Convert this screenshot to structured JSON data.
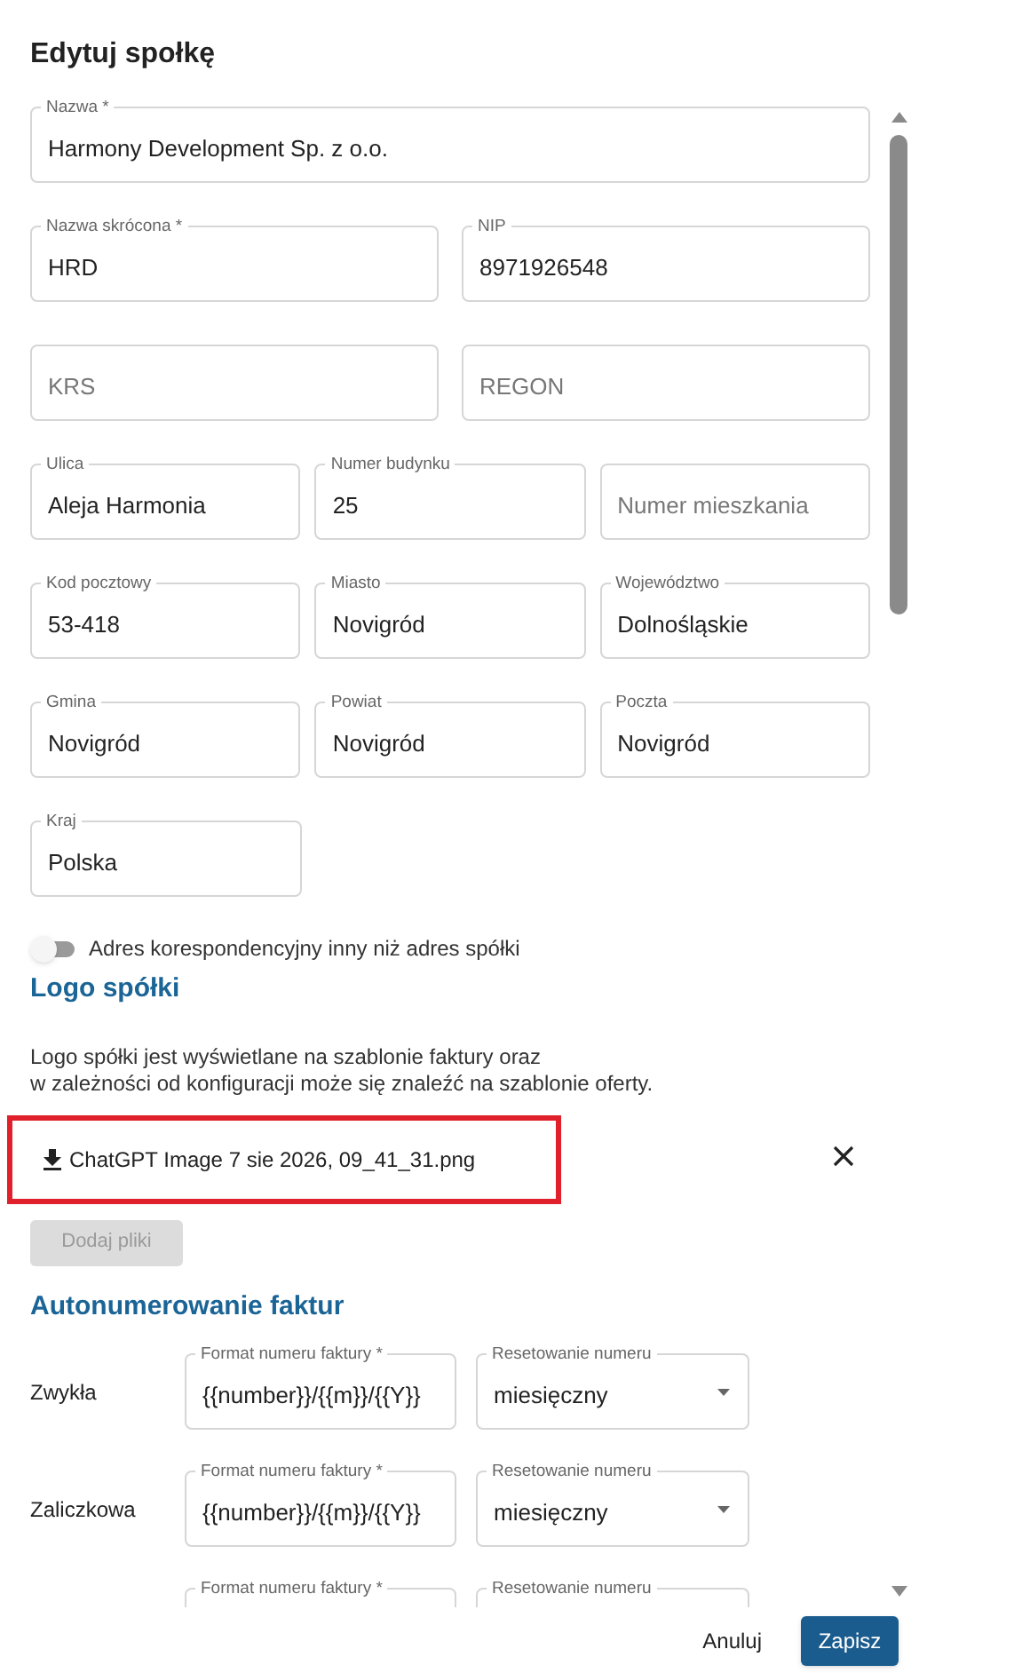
{
  "dialog": {
    "title": "Edytuj społkę"
  },
  "field_rows": [
    [
      {
        "label": "Nazwa *",
        "value": "Harmony Development Sp. z o.o."
      }
    ],
    [
      {
        "label": "Nazwa skrócona *",
        "value": "HRD"
      },
      {
        "label": "NIP",
        "value": "8971926548"
      }
    ],
    [
      {
        "placeholder": "KRS"
      },
      {
        "placeholder": "REGON"
      }
    ],
    [
      {
        "label": "Ulica",
        "value": "Aleja Harmonia"
      },
      {
        "label": "Numer budynku",
        "value": "25"
      },
      {
        "placeholder": "Numer mieszkania"
      }
    ],
    [
      {
        "label": "Kod pocztowy",
        "value": "53-418"
      },
      {
        "label": "Miasto",
        "value": "Novigród"
      },
      {
        "label": "Województwo",
        "value": "Dolnośląskie"
      }
    ],
    [
      {
        "label": "Gmina",
        "value": "Novigród"
      },
      {
        "label": "Powiat",
        "value": "Novigród"
      },
      {
        "label": "Poczta",
        "value": "Novigród"
      }
    ],
    [
      {
        "label": "Kraj",
        "value": "Polska"
      }
    ]
  ],
  "correspondence_toggle": {
    "label": "Adres korespondencyjny inny niż adres spółki",
    "on": false
  },
  "logo_section": {
    "heading": "Logo spółki",
    "description": "Logo spółki jest wyświetlane na szablonie faktury oraz\nw zależności od konfiguracji może się znaleźć na szablonie oferty.",
    "file": {
      "name": "ChatGPT Image 7 sie 2026, 09_41_31.png",
      "highlighted": true
    },
    "add_button": {
      "label": "Dodaj pliki",
      "disabled": true
    }
  },
  "numbering_section": {
    "heading": "Autonumerowanie faktur",
    "rows": [
      {
        "name": "Zwykła",
        "format_label": "Format numeru faktury *",
        "format": "{{number}}/{{m}}/{{Y}}",
        "reset_label": "Resetowanie numeru",
        "reset": "miesięczny"
      },
      {
        "name": "Zaliczkowa",
        "format_label": "Format numeru faktury *",
        "format": "{{number}}/{{m}}/{{Y}}",
        "reset_label": "Resetowanie numeru",
        "reset": "miesięczny"
      },
      {
        "format_label": "Format numeru faktury *",
        "reset_label": "Resetowanie numeru"
      }
    ]
  },
  "footer": {
    "cancel": "Anuluj",
    "save": "Zapisz"
  }
}
